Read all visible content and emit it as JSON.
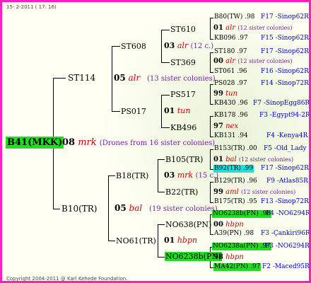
{
  "header": {
    "date": "15-  2-2011  ( 17: 16)"
  },
  "footer": {
    "copyright": "Copyright 2004-2011 @ Karl Kehede Foundation."
  },
  "root": {
    "name": "B41(MKK)",
    "code": "08",
    "line": "mrk",
    "note": "(Drones from 16 sister colonies)"
  },
  "father_side": {
    "gen1": {
      "name": "ST114",
      "code": "05",
      "line": "alr",
      "note": "(13 sister colonies)"
    },
    "gen2a": {
      "name": "ST608",
      "code": "03",
      "line": "alr",
      "note": "(12 c.)"
    },
    "gen2b": {
      "name": "PS017",
      "code": "01",
      "line": "tun"
    },
    "gen3": [
      {
        "name": "ST610",
        "code": "01",
        "line": "alr",
        "note": "(12 sister colonies)"
      },
      {
        "name": "ST369",
        "code": "00",
        "line": "alr",
        "note": "(12 sister colonies)"
      },
      {
        "name": "PS517",
        "code": "99",
        "line": "tun"
      },
      {
        "name": "KB496",
        "code": "97",
        "line": "nex"
      }
    ],
    "gen4": [
      {
        "id": "B80(TW) .98",
        "ref": "F17 -Sinop62R"
      },
      {
        "id": "KB096 .97",
        "ref": "F15 -Sinop62R"
      },
      {
        "id": "ST180 .97",
        "ref": "F17 -Sinop62R"
      },
      {
        "id": "ST061 .96",
        "ref": "F16 -Sinop62R"
      },
      {
        "id": "PS028 .97",
        "ref": "F14 -Sinop72R"
      },
      {
        "id": "KB430 .96",
        "ref": "F7 -SinopEgg86R"
      },
      {
        "id": "KB178 .96",
        "ref": "F3 -Egypt94-2R"
      },
      {
        "id": "KB131 .94",
        "ref": "F4 -Kenya4R"
      }
    ]
  },
  "mother_side": {
    "gen1": {
      "name": "B10(TR)",
      "code": "05",
      "line": "bal",
      "note": "(19 sister colonies)"
    },
    "gen2a": {
      "name": "B18(TR)",
      "code": "03",
      "line": "mrk",
      "note": "(15 c.)"
    },
    "gen2b": {
      "name": "NO61(TR)",
      "code": "01",
      "line": "hbpn"
    },
    "gen3": [
      {
        "name": "B105(TR)",
        "code": "01",
        "line": "bal",
        "note": "(12 sister colonies)"
      },
      {
        "name": "B22(TR)",
        "code": "99",
        "line": "aml",
        "note": "(12 sister colonies)"
      },
      {
        "name": "NO638(PN)",
        "code": "00",
        "line": "hbpn"
      },
      {
        "name": "NO6238b(PN)",
        "code": "98",
        "line": "hbpn"
      }
    ],
    "gen4": [
      {
        "id": "B153(TR) .00",
        "ref": "F5 -Old_Lady"
      },
      {
        "id": "B92(TR) .99",
        "ref": "F17 -Sinop62R"
      },
      {
        "id": "B129(TR) .96",
        "ref": "F9 -Atlas85R"
      },
      {
        "id": "B175(TR) .95",
        "ref": "F13 -Sinop72R"
      },
      {
        "id": "NO6238b(PN) .98",
        "ref": "F4 -NO6294R"
      },
      {
        "id": "A39(PN) .98",
        "ref": "F3 -Çankiri96R"
      },
      {
        "id": "NO6238a(PN) .97",
        "ref": "F3 -NO6294R"
      },
      {
        "id": "MA42(PN) .97",
        "ref": "F2 -Maced95R"
      }
    ]
  }
}
